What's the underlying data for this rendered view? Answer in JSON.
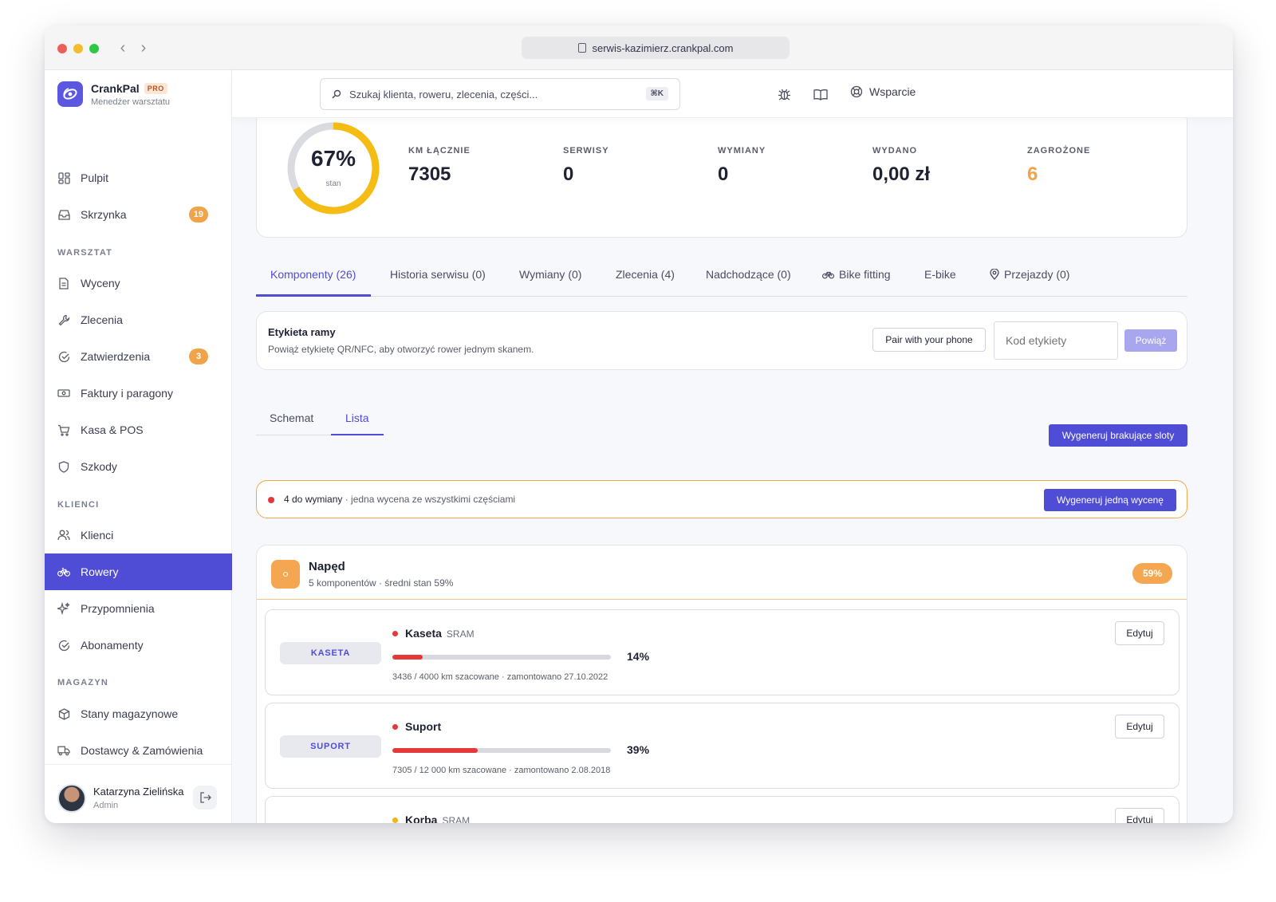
{
  "browser": {
    "url": "serwis-kazimierz.crankpal.com"
  },
  "brand": {
    "name": "CrankPal",
    "badge": "PRO",
    "subtitle": "Menedżer warsztatu"
  },
  "sidebar": {
    "top": [
      {
        "label": "Pulpit"
      },
      {
        "label": "Skrzynka",
        "badge": "19"
      }
    ],
    "sections": {
      "warsztat": "WARSZTAT",
      "klienci": "KLIENCI",
      "magazyn": "MAGAZYN"
    },
    "warsztat": [
      {
        "label": "Wyceny"
      },
      {
        "label": "Zlecenia"
      },
      {
        "label": "Zatwierdzenia",
        "badge": "3"
      },
      {
        "label": "Faktury i paragony"
      },
      {
        "label": "Kasa & POS"
      },
      {
        "label": "Szkody"
      }
    ],
    "klienci": [
      {
        "label": "Klienci"
      },
      {
        "label": "Rowery"
      },
      {
        "label": "Przypomnienia"
      },
      {
        "label": "Abonamenty"
      }
    ],
    "magazyn": [
      {
        "label": "Stany magazynowe"
      },
      {
        "label": "Dostawcy & Zamówienia"
      }
    ]
  },
  "user": {
    "name": "Katarzyna Zielińska",
    "role": "Admin"
  },
  "header": {
    "search_placeholder": "Szukaj klienta, roweru, zlecenia, części...",
    "shortcut": "⌘K",
    "support": "Wsparcie"
  },
  "stats": {
    "health": {
      "value": "67%",
      "label": "stan",
      "fraction": 0.67
    },
    "items": [
      {
        "label": "KM ŁĄCZNIE",
        "value": "7305"
      },
      {
        "label": "SERWISY",
        "value": "0"
      },
      {
        "label": "WYMIANY",
        "value": "0"
      },
      {
        "label": "WYDANO",
        "value": "0,00 zł"
      },
      {
        "label": "ZAGROŻONE",
        "value": "6"
      }
    ]
  },
  "tabs": [
    "Komponenty (26)",
    "Historia serwisu (0)",
    "Wymiany (0)",
    "Zlecenia (4)",
    "Nadchodzące (0)",
    "Bike fitting",
    "E-bike",
    "Przejazdy (0)"
  ],
  "frame_label": {
    "title": "Etykieta ramy",
    "subtitle": "Powiąż etykietę QR/NFC, aby otworzyć rower jednym skanem.",
    "pair_button": "Pair with your phone",
    "code_placeholder": "Kod etykiety",
    "link_button": "Powiąż"
  },
  "view_tabs": {
    "schema": "Schemat",
    "list": "Lista"
  },
  "generate_slots": "Wygeneruj brakujące sloty",
  "alert": {
    "strong": "4 do wymiany",
    "text": " · jedna wycena ze wszystkimi częściami",
    "button": "Wygeneruj jedną wycenę"
  },
  "group": {
    "title": "Napęd",
    "subtitle": "5 komponentów · średni stan 59%",
    "badge": "59%"
  },
  "edit_label": "Edytuj",
  "components": [
    {
      "tag": "KASETA",
      "name": "Kaseta",
      "brand": "SRAM",
      "pct": "14%",
      "fraction": 0.14,
      "meta": "3436 / 4000 km szacowane · zamontowano 27.10.2022",
      "status_color": "#e5383b"
    },
    {
      "tag": "SUPORT",
      "name": "Suport",
      "brand": "",
      "pct": "39%",
      "fraction": 0.39,
      "meta": "7305 / 12 000 km szacowane · zamontowano 2.08.2018",
      "status_color": "#e5383b"
    },
    {
      "tag": "",
      "name": "Korba",
      "brand": "SRAM",
      "pct": "",
      "fraction": null,
      "meta": "",
      "status_color": "#f2b418"
    }
  ]
}
